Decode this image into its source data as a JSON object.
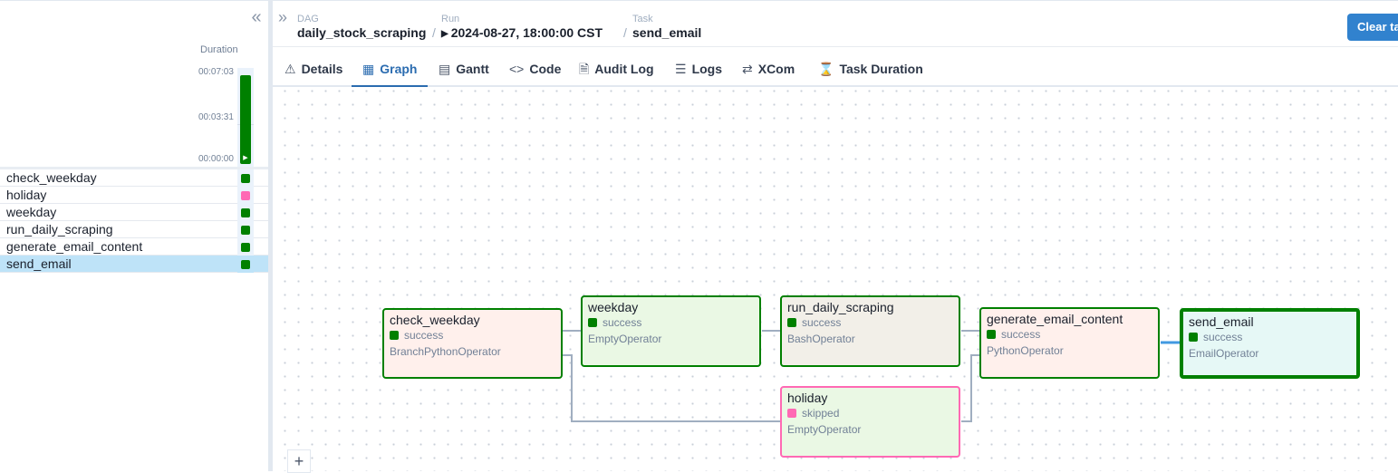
{
  "left_panel": {
    "duration_label": "Duration",
    "ticks": [
      "00:07:03",
      "00:03:31",
      "00:00:00"
    ],
    "run_duration_fraction": 0.98,
    "tasks": [
      {
        "name": "check_weekday",
        "state_color": "#008000"
      },
      {
        "name": "holiday",
        "state_color": "#ff69b4"
      },
      {
        "name": "weekday",
        "state_color": "#008000"
      },
      {
        "name": "run_daily_scraping",
        "state_color": "#008000"
      },
      {
        "name": "generate_email_content",
        "state_color": "#008000"
      },
      {
        "name": "send_email",
        "state_color": "#008000"
      }
    ]
  },
  "breadcrumb": {
    "dag_label": "DAG",
    "dag_value": "daily_stock_scraping",
    "run_label": "Run",
    "run_value": "2024-08-27, 18:00:00 CST",
    "task_label": "Task",
    "task_value": "send_email"
  },
  "clear_button": "Clear ta",
  "tabs": [
    {
      "label": "Details",
      "icon": "warning-icon"
    },
    {
      "label": "Graph",
      "icon": "graph-icon"
    },
    {
      "label": "Gantt",
      "icon": "gantt-icon"
    },
    {
      "label": "Code",
      "icon": "code-icon"
    },
    {
      "label": "Audit Log",
      "icon": "audit-log-icon"
    },
    {
      "label": "Logs",
      "icon": "logs-icon"
    },
    {
      "label": "XCom",
      "icon": "xcom-icon"
    },
    {
      "label": "Task Duration",
      "icon": "hourglass-icon"
    }
  ],
  "graph": {
    "nodes": [
      {
        "name": "check_weekday",
        "state": "success",
        "operator": "BranchPythonOperator"
      },
      {
        "name": "weekday",
        "state": "success",
        "operator": "EmptyOperator"
      },
      {
        "name": "run_daily_scraping",
        "state": "success",
        "operator": "BashOperator"
      },
      {
        "name": "holiday",
        "state": "skipped",
        "operator": "EmptyOperator"
      },
      {
        "name": "generate_email_content",
        "state": "success",
        "operator": "PythonOperator"
      },
      {
        "name": "send_email",
        "state": "success",
        "operator": "EmailOperator"
      }
    ],
    "colors": {
      "success": "#008000",
      "skipped": "#ff69b4",
      "selected_edge": "#4299e1",
      "edge": "#a0aec0"
    }
  },
  "zoom_in": "+"
}
